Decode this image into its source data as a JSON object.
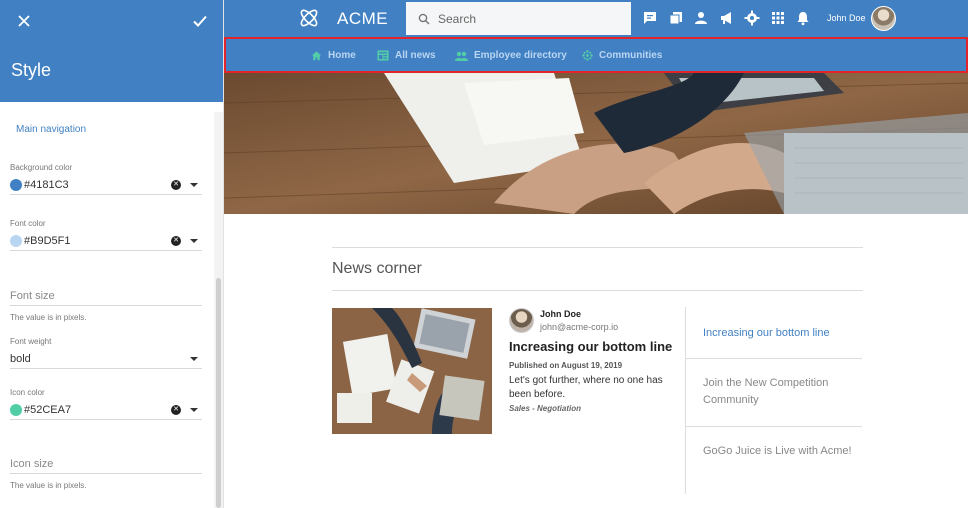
{
  "colors": {
    "primary": "#4181C3",
    "nav_font": "#B9D5F1",
    "icon": "#52CEA7",
    "highlight_border": "#e3242b"
  },
  "panel": {
    "title": "Style",
    "close_icon": "close-icon",
    "confirm_icon": "check-icon",
    "section": "Main navigation",
    "background_color": {
      "label": "Background color",
      "value": "#4181C3",
      "swatch": "#4181C3"
    },
    "font_color": {
      "label": "Font color",
      "value": "#B9D5F1",
      "swatch": "#B9D5F1"
    },
    "font_size": {
      "placeholder": "Font size",
      "hint": "The value is in pixels."
    },
    "font_weight": {
      "label": "Font weight",
      "value": "bold"
    },
    "icon_color": {
      "label": "Icon color",
      "value": "#52CEA7",
      "swatch": "#52CEA7"
    },
    "icon_size": {
      "placeholder": "Icon size",
      "hint": "The value is in pixels."
    }
  },
  "appbar": {
    "brand": "ACME",
    "search_placeholder": "Search",
    "icons": [
      "chat-icon",
      "pages-icon",
      "person-icon",
      "megaphone-icon",
      "settings-icon",
      "apps-grid-icon",
      "notification-bell-icon"
    ],
    "user_name": "John Doe"
  },
  "main_nav": {
    "items": [
      {
        "label": "Home",
        "icon": "home-icon"
      },
      {
        "label": "All news",
        "icon": "news-icon"
      },
      {
        "label": "Employee directory",
        "icon": "people-icon"
      },
      {
        "label": "Communities",
        "icon": "communities-icon"
      }
    ]
  },
  "news": {
    "title": "News corner",
    "featured": {
      "author": "John Doe",
      "email": "john@acme-corp.io",
      "headline": "Increasing our bottom line",
      "published": "Published on August 19, 2019",
      "summary": "Let's got further, where no one has been before.",
      "tags": "Sales - Negotiation"
    },
    "side_list": [
      "Increasing our bottom line",
      "Join the New Competition Community",
      "GoGo Juice is Live with Acme!"
    ]
  }
}
